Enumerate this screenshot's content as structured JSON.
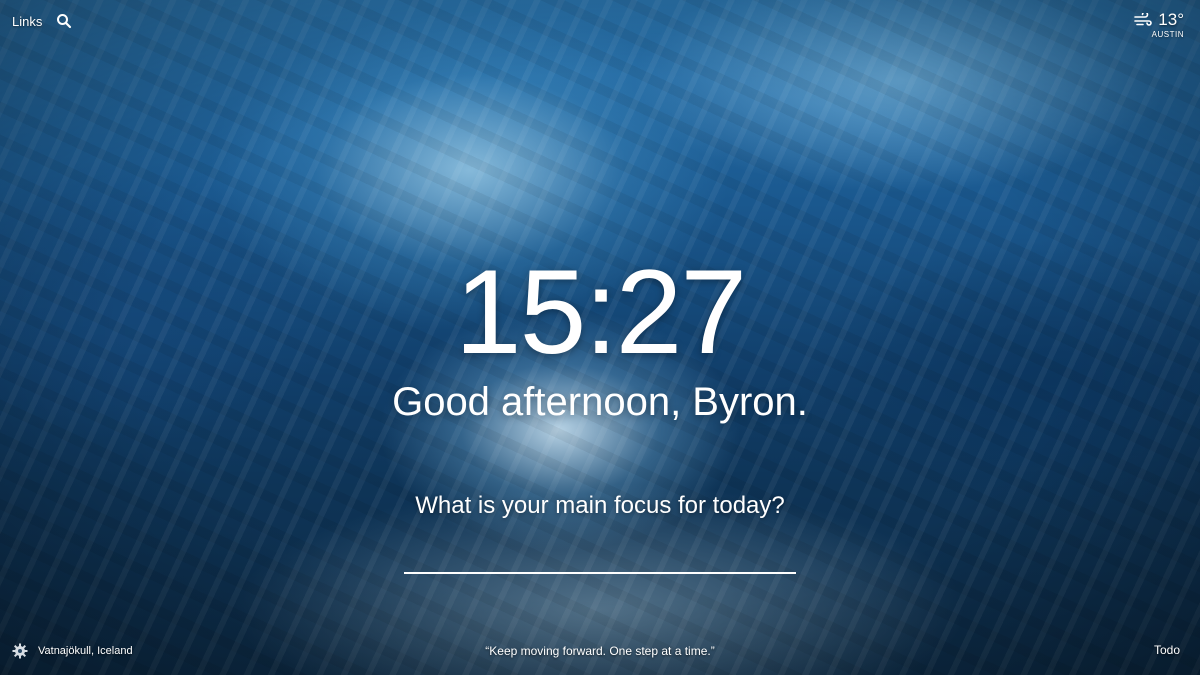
{
  "header": {
    "links_label": "Links",
    "search_icon": "search-icon"
  },
  "weather": {
    "icon": "wind-icon",
    "temperature": "13°",
    "location": "AUSTIN"
  },
  "clock": {
    "time": "15:27"
  },
  "greeting": {
    "text": "Good afternoon, Byron."
  },
  "focus": {
    "question": "What is your main focus for today?",
    "input_value": "",
    "input_placeholder": ""
  },
  "footer": {
    "settings_icon": "gear-icon",
    "photo_location": "Vatnajökull, Iceland",
    "quote": "“Keep moving forward. One step at a time.”",
    "todo_label": "Todo"
  }
}
